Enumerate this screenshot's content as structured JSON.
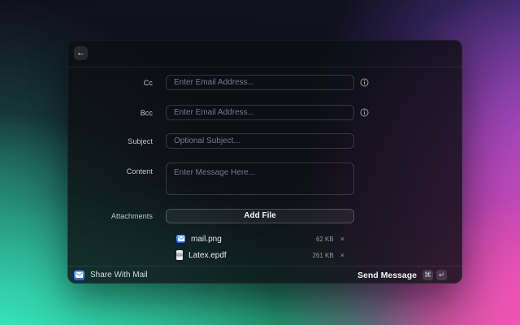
{
  "window": {
    "header": {
      "back_label": "←"
    },
    "form": {
      "cc": {
        "label": "Cc",
        "placeholder": "Enter Email Address..."
      },
      "bcc": {
        "label": "Bcc",
        "placeholder": "Enter Email Address..."
      },
      "subject": {
        "label": "Subject",
        "placeholder": "Optional Subject..."
      },
      "content": {
        "label": "Content",
        "placeholder": "Enter Message Here..."
      }
    },
    "attachments_section": {
      "label": "Attachments",
      "add_file_label": "Add File"
    },
    "attachments": [
      {
        "name": "mail.png",
        "size": "62 KB",
        "icon": "mail-app-icon",
        "remove_label": "×"
      },
      {
        "name": "Latex.epdf",
        "size": "261 KB",
        "icon": "document-icon",
        "remove_label": "×"
      }
    ],
    "footer": {
      "app_name": "Share With Mail",
      "send_label": "Send Message",
      "shortcuts": [
        "⌘",
        "↵"
      ]
    }
  },
  "colors": {
    "mail_icon_blue": "#1a63ee",
    "bg_teal": "#3cffcf",
    "bg_green": "#1f9e66",
    "bg_purple": "#7a4fe0",
    "bg_pink": "#ff4fc3"
  }
}
